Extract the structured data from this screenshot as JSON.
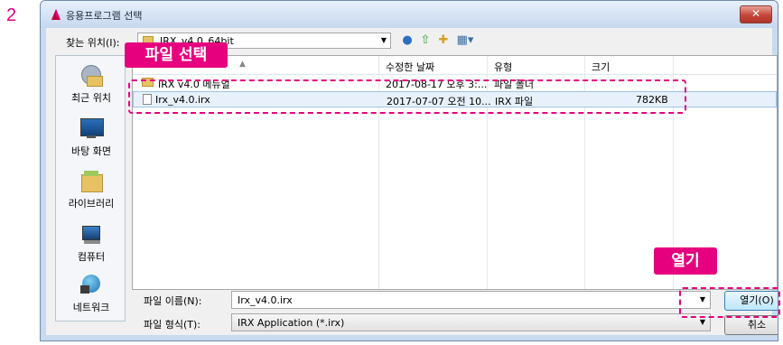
{
  "step_number": "2",
  "window": {
    "title": "응용프로그램 선택",
    "close_label": "✕"
  },
  "toolbar": {
    "lookin_label": "찾는 위치(I):",
    "lookin_value": "IRX_v4.0_64bit",
    "icons": [
      "back-icon",
      "up-folder-icon",
      "new-folder-icon",
      "view-menu-icon"
    ]
  },
  "places": [
    {
      "label": "최근 위치",
      "icon": "recent-places-icon"
    },
    {
      "label": "바탕 화면",
      "icon": "desktop-icon"
    },
    {
      "label": "라이브러리",
      "icon": "libraries-icon"
    },
    {
      "label": "컴퓨터",
      "icon": "computer-icon"
    },
    {
      "label": "네트워크",
      "icon": "network-icon"
    }
  ],
  "list": {
    "columns": [
      "수정한 날짜",
      "유형",
      "크기"
    ],
    "rows": [
      {
        "name": "IRX v4.0 메뉴얼",
        "date": "2017-08-17 오후 3:...",
        "type": "파일 폴더",
        "size": "",
        "icon": "folder-icon"
      },
      {
        "name": "Irx_v4.0.irx",
        "date": "2017-07-07 오전 10...",
        "type": "IRX 파일",
        "size": "782KB",
        "icon": "file-icon",
        "selected": true
      }
    ]
  },
  "filename": {
    "label": "파일 이름(N):",
    "value": "Irx_v4.0.irx"
  },
  "filetype": {
    "label": "파일 형식(T):",
    "value": "IRX Application (*.irx)"
  },
  "buttons": {
    "open": "열기(O)",
    "cancel": "취소"
  },
  "callouts": {
    "select_file": "파일 선택",
    "open": "열기"
  },
  "colors": {
    "accent": "#e6007e",
    "selection": "#e8f1fb",
    "close": "#c6463a"
  }
}
